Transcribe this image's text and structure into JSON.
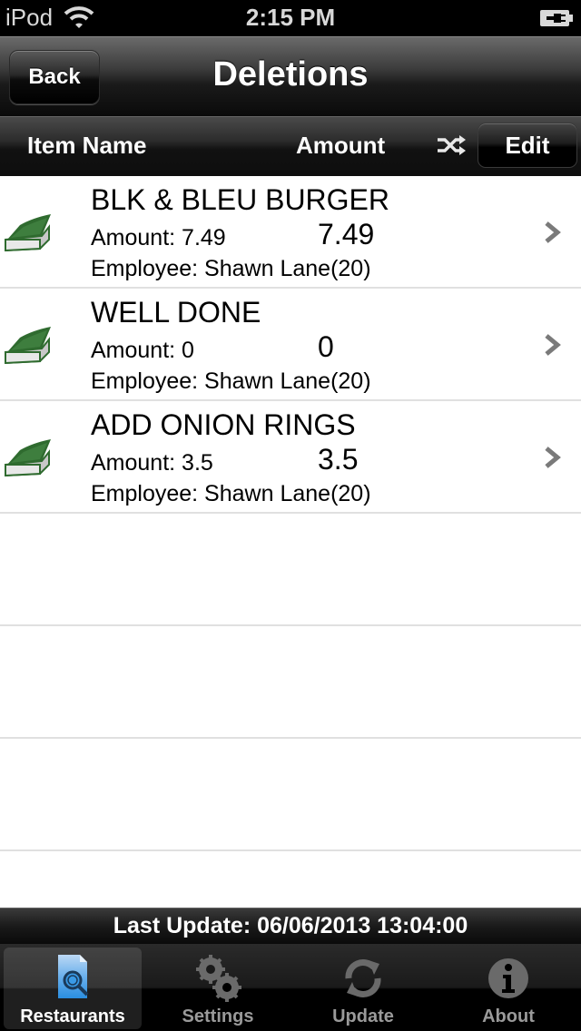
{
  "status_bar": {
    "carrier": "iPod",
    "time": "2:15 PM"
  },
  "nav": {
    "back_label": "Back",
    "title": "Deletions"
  },
  "columns": {
    "item_name": "Item Name",
    "amount": "Amount",
    "edit_label": "Edit"
  },
  "rows": [
    {
      "name": "BLK & BLEU BURGER",
      "amount_label": "Amount: 7.49",
      "amount_value": "7.49",
      "employee": "Employee: Shawn Lane(20)"
    },
    {
      "name": "WELL DONE",
      "amount_label": "Amount: 0",
      "amount_value": "0",
      "employee": "Employee: Shawn Lane(20)"
    },
    {
      "name": "ADD ONION RINGS",
      "amount_label": "Amount: 3.5",
      "amount_value": "3.5",
      "employee": "Employee: Shawn Lane(20)"
    }
  ],
  "footer": {
    "last_update": "Last Update: 06/06/2013 13:04:00"
  },
  "tabs": [
    {
      "label": "Restaurants",
      "icon": "document-search-icon",
      "active": true
    },
    {
      "label": "Settings",
      "icon": "gears-icon",
      "active": false
    },
    {
      "label": "Update",
      "icon": "refresh-icon",
      "active": false
    },
    {
      "label": "About",
      "icon": "info-icon",
      "active": false
    }
  ],
  "colors": {
    "book_green": "#2f6b2f",
    "tab_active_icon": "#3aa0e8"
  }
}
